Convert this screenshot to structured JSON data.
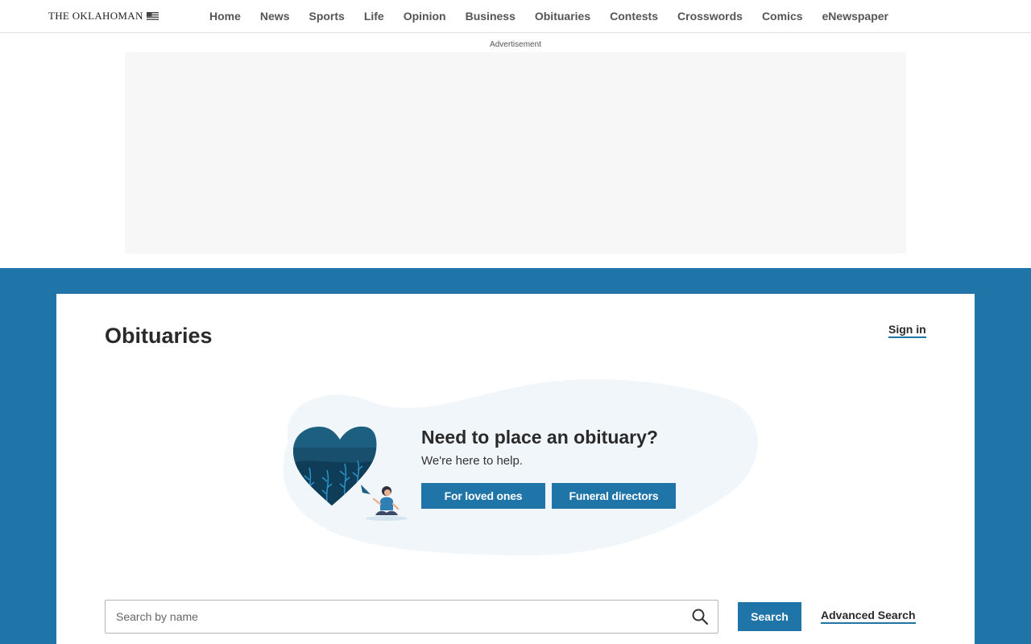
{
  "header": {
    "logo_text": "THE OKLAHOMAN",
    "logo_icon": "flag-icon",
    "nav": [
      {
        "label": "Home"
      },
      {
        "label": "News"
      },
      {
        "label": "Sports"
      },
      {
        "label": "Life"
      },
      {
        "label": "Opinion"
      },
      {
        "label": "Business"
      },
      {
        "label": "Obituaries"
      },
      {
        "label": "Contests"
      },
      {
        "label": "Crosswords"
      },
      {
        "label": "Comics"
      },
      {
        "label": "eNewspaper"
      }
    ]
  },
  "ad": {
    "label": "Advertisement"
  },
  "page": {
    "title": "Obituaries",
    "sign_in": "Sign in"
  },
  "promo": {
    "title": "Need to place an obituary?",
    "subtitle": "We're here to help.",
    "loved_ones_label": "For loved ones",
    "funeral_directors_label": "Funeral directors",
    "illustration": "heart-person-illustration"
  },
  "search": {
    "placeholder": "Search by name",
    "value": "",
    "button_label": "Search",
    "advanced_label": "Advanced Search",
    "icon": "search-icon"
  },
  "colors": {
    "brand_blue": "#1f74a8",
    "blob": "#f1f6fa",
    "ad_bg": "#f7f7f7"
  }
}
